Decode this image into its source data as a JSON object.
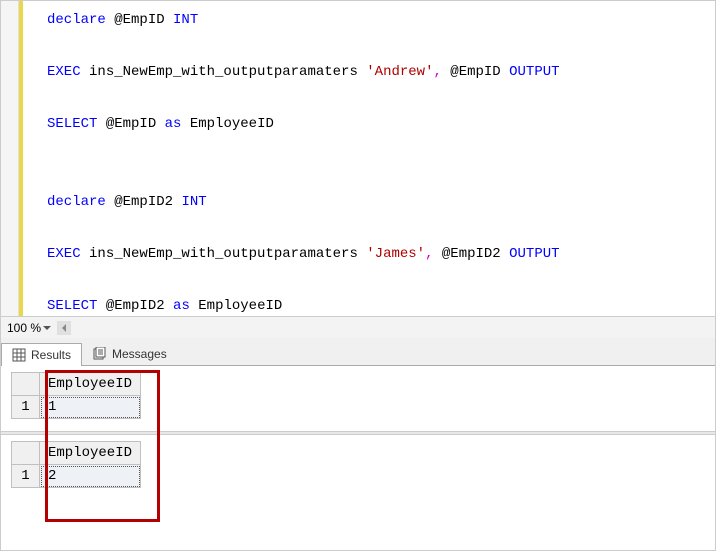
{
  "code": {
    "lines": [
      {
        "t": [
          {
            "c": "kw-blue",
            "s": "declare"
          },
          {
            "c": "",
            "s": " @EmpID "
          },
          {
            "c": "kw-blue",
            "s": "INT"
          }
        ]
      },
      {
        "t": []
      },
      {
        "t": [
          {
            "c": "kw-blue",
            "s": "EXEC"
          },
          {
            "c": "",
            "s": " ins_NewEmp_with_outputparamaters "
          },
          {
            "c": "kw-red",
            "s": "'Andrew'"
          },
          {
            "c": "kw-pink",
            "s": ","
          },
          {
            "c": "",
            "s": " @EmpID "
          },
          {
            "c": "kw-blue",
            "s": "OUTPUT"
          }
        ]
      },
      {
        "t": []
      },
      {
        "t": [
          {
            "c": "kw-blue",
            "s": "SELECT"
          },
          {
            "c": "",
            "s": " @EmpID "
          },
          {
            "c": "kw-blue",
            "s": "as"
          },
          {
            "c": "",
            "s": " EmployeeID"
          }
        ]
      },
      {
        "t": []
      },
      {
        "t": []
      },
      {
        "t": [
          {
            "c": "kw-blue",
            "s": "declare"
          },
          {
            "c": "",
            "s": " @EmpID2 "
          },
          {
            "c": "kw-blue",
            "s": "INT"
          }
        ]
      },
      {
        "t": []
      },
      {
        "t": [
          {
            "c": "kw-blue",
            "s": "EXEC"
          },
          {
            "c": "",
            "s": " ins_NewEmp_with_outputparamaters "
          },
          {
            "c": "kw-red",
            "s": "'James'"
          },
          {
            "c": "kw-pink",
            "s": ","
          },
          {
            "c": "",
            "s": " @EmpID2 "
          },
          {
            "c": "kw-blue",
            "s": "OUTPUT"
          }
        ]
      },
      {
        "t": []
      },
      {
        "t": [
          {
            "c": "kw-blue",
            "s": "SELECT"
          },
          {
            "c": "",
            "s": " @EmpID2 "
          },
          {
            "c": "kw-blue",
            "s": "as"
          },
          {
            "c": "",
            "s": " EmployeeID"
          }
        ]
      }
    ]
  },
  "zoom": {
    "level": "100 %"
  },
  "tabs": {
    "results": "Results",
    "messages": "Messages"
  },
  "results": [
    {
      "header": "EmployeeID",
      "rownum": "1",
      "value": "1"
    },
    {
      "header": "EmployeeID",
      "rownum": "1",
      "value": "2"
    }
  ]
}
